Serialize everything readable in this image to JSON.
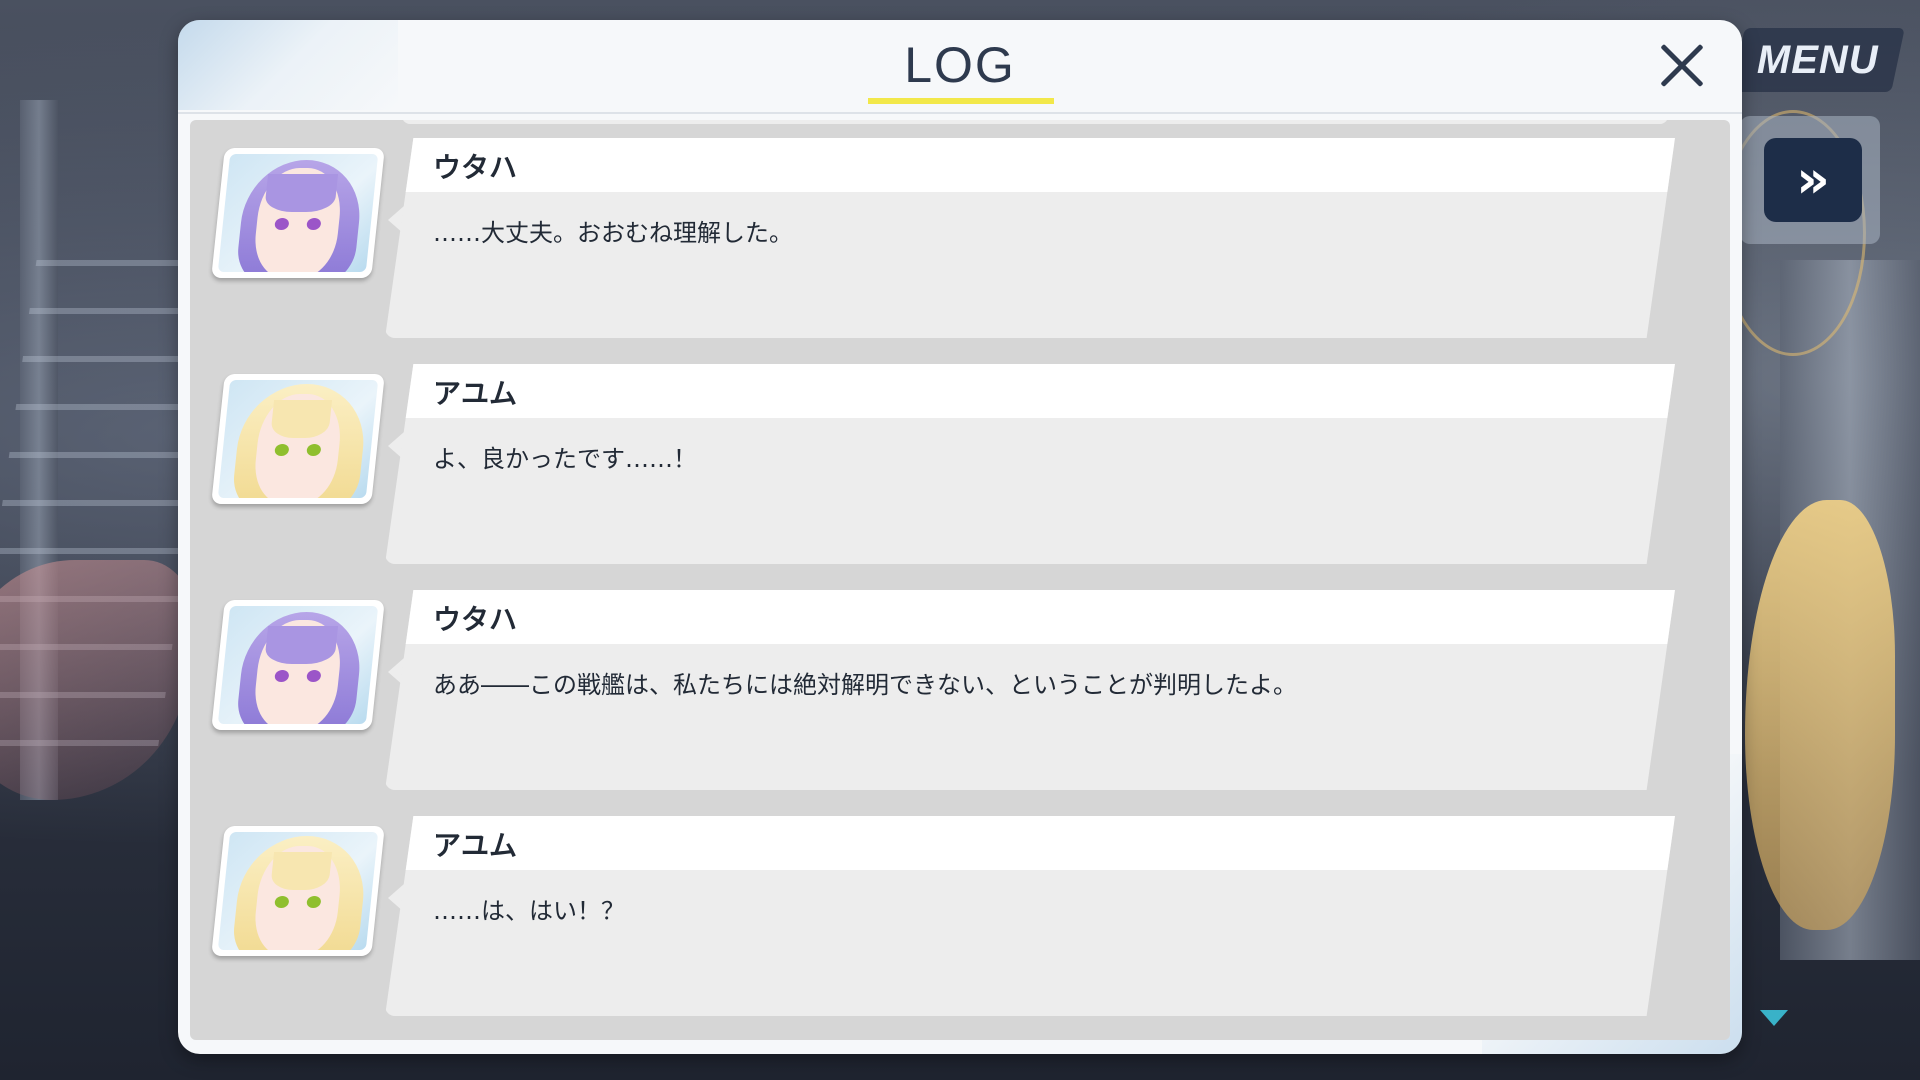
{
  "menu": {
    "label": "MENU"
  },
  "log": {
    "title": "LOG",
    "entries": [
      {
        "speaker": "ウタハ",
        "text": "……大丈夫。おおむね理解した。",
        "portrait": "utaha-portrait"
      },
      {
        "speaker": "アユム",
        "text": "よ、良かったです……！",
        "portrait": "ayumu-portrait"
      },
      {
        "speaker": "ウタハ",
        "text": "ああ――この戦艦は、私たちには絶対解明できない、ということが判明したよ。",
        "portrait": "utaha-portrait"
      },
      {
        "speaker": "アユム",
        "text": "……は、はい！？",
        "portrait": "ayumu-portrait"
      }
    ]
  },
  "colors": {
    "panel_background": "#f6f8fa",
    "title_underline": "#f2e84a",
    "title_text": "#2e3a4e",
    "list_background": "#d6d6d6",
    "bubble": "#ededed",
    "skip_button": "#1d2d48",
    "scroll_arrow": "#39b2c8"
  },
  "icons": {
    "close": "close-icon",
    "fast_forward": "fast-forward-icon",
    "scroll_down": "scroll-down-arrow-icon"
  }
}
